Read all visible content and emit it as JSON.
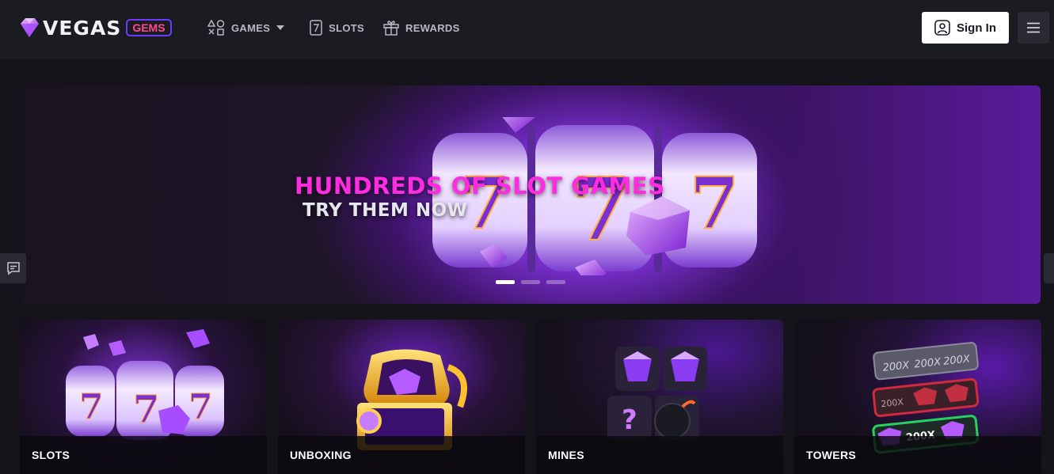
{
  "header": {
    "logo_text": "VEGAS",
    "logo_badge": "GEMS",
    "nav": [
      {
        "label": "GAMES",
        "icon": "games-icon",
        "has_dropdown": true
      },
      {
        "label": "SLOTS",
        "icon": "slot-seven-icon"
      },
      {
        "label": "REWARDS",
        "icon": "gift-icon"
      }
    ],
    "sign_in_label": "Sign In"
  },
  "hero": {
    "title": "HUNDREDS OF SLOT GAMES",
    "subtitle": "TRY THEM NOW",
    "slide_count": 3,
    "active_slide": 1
  },
  "games": [
    {
      "label": "SLOTS"
    },
    {
      "label": "UNBOXING"
    },
    {
      "label": "MINES"
    },
    {
      "label": "TOWERS"
    }
  ],
  "colors": {
    "background": "#14141a",
    "header": "#1b1b22",
    "accent_pink": "#ff2be0",
    "badge_border": "#6c3bff",
    "badge_text": "#ff4a8a"
  },
  "icons": {
    "chat": "chat-icon",
    "menu": "hamburger-menu-icon",
    "user": "user-icon"
  }
}
